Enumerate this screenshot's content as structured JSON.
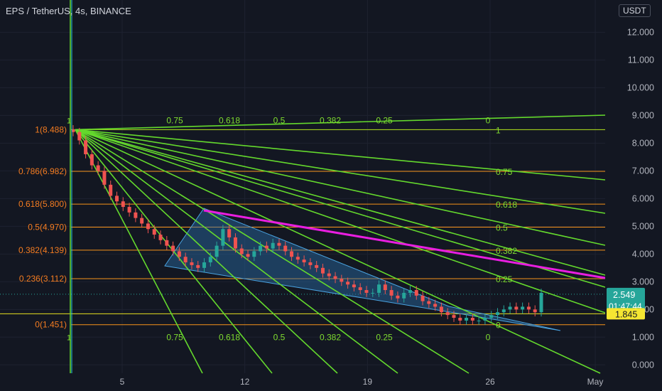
{
  "header": {
    "symbol_title": "EPS / TetherUS, 4s, BINANCE",
    "currency_button": "USDT"
  },
  "colors": {
    "background": "#131722",
    "fib_line": "#f7931a",
    "fan_line": "#64d92d",
    "fan_label": "#7fdc2f",
    "fib_label": "#f47c20",
    "pink_line": "#e91ee0",
    "candle_up": "#26a69a",
    "candle_down": "#ef5350",
    "wedge_fill": "#2a6fa8",
    "wedge_stroke": "#4aa3e0",
    "price_badge": "#26a69a",
    "level_badge": "#f5e632"
  },
  "chart_data": {
    "type": "candlestick",
    "y_axis": {
      "ylim": [
        -0.3,
        12.6
      ],
      "tick_labels": [
        "0.000",
        "1.000",
        "2.000",
        "3.000",
        "4.000",
        "5.000",
        "6.000",
        "7.000",
        "8.000",
        "9.000",
        "10.000",
        "11.000",
        "12.000"
      ],
      "ticks": [
        0,
        1,
        2,
        3,
        4,
        5,
        6,
        7,
        8,
        9,
        10,
        11,
        12
      ]
    },
    "x_axis": {
      "tick_labels": [
        "5",
        "12",
        "19",
        "26",
        "May"
      ],
      "ticks": [
        5,
        12,
        19,
        26,
        32
      ]
    },
    "fib_levels": [
      {
        "label": "1(8.488)",
        "value": 8.488
      },
      {
        "label": "0.786(6.982)",
        "value": 6.982
      },
      {
        "label": "0.618(5.800)",
        "value": 5.8
      },
      {
        "label": "0.5(4.970)",
        "value": 4.97
      },
      {
        "label": "0.382(4.139)",
        "value": 4.139
      },
      {
        "label": "0.236(3.112)",
        "value": 3.112
      },
      {
        "label": "0(1.451)",
        "value": 1.451
      }
    ],
    "fan_labels_top": [
      "0.75",
      "0.618",
      "0.5",
      "0.382",
      "0.25",
      "0"
    ],
    "fan_labels_bottom": [
      "0.75",
      "0.618",
      "0.5",
      "0.382",
      "0.25",
      "0"
    ],
    "fan_labels_right": [
      "1",
      "0.75",
      "0.618",
      "0.5",
      "0.382",
      "0.25",
      "0"
    ],
    "fan_corner_labels": [
      "1",
      "1"
    ],
    "last_price": {
      "value": "2.549",
      "countdown": "01:47:44"
    },
    "level_price": "1.845",
    "close_series": [
      8.4,
      8.1,
      7.6,
      7.2,
      7.0,
      6.5,
      6.1,
      5.9,
      5.7,
      5.5,
      5.3,
      5.1,
      4.9,
      4.7,
      4.5,
      4.3,
      4.1,
      3.9,
      3.7,
      3.6,
      3.5,
      3.7,
      3.9,
      4.3,
      4.9,
      4.6,
      4.2,
      4.0,
      3.9,
      4.1,
      4.3,
      4.2,
      4.4,
      4.3,
      4.1,
      3.9,
      3.8,
      3.7,
      3.6,
      3.5,
      3.3,
      3.2,
      3.1,
      3.0,
      2.9,
      2.8,
      2.7,
      2.6,
      2.6,
      2.9,
      2.7,
      2.5,
      2.4,
      2.6,
      2.7,
      2.5,
      2.3,
      2.2,
      2.1,
      1.9,
      1.8,
      1.7,
      1.6,
      1.7,
      1.6,
      1.6,
      1.7,
      1.8,
      1.9,
      2.0,
      2.1,
      2.0,
      2.1,
      2.0,
      1.9,
      2.6
    ]
  }
}
